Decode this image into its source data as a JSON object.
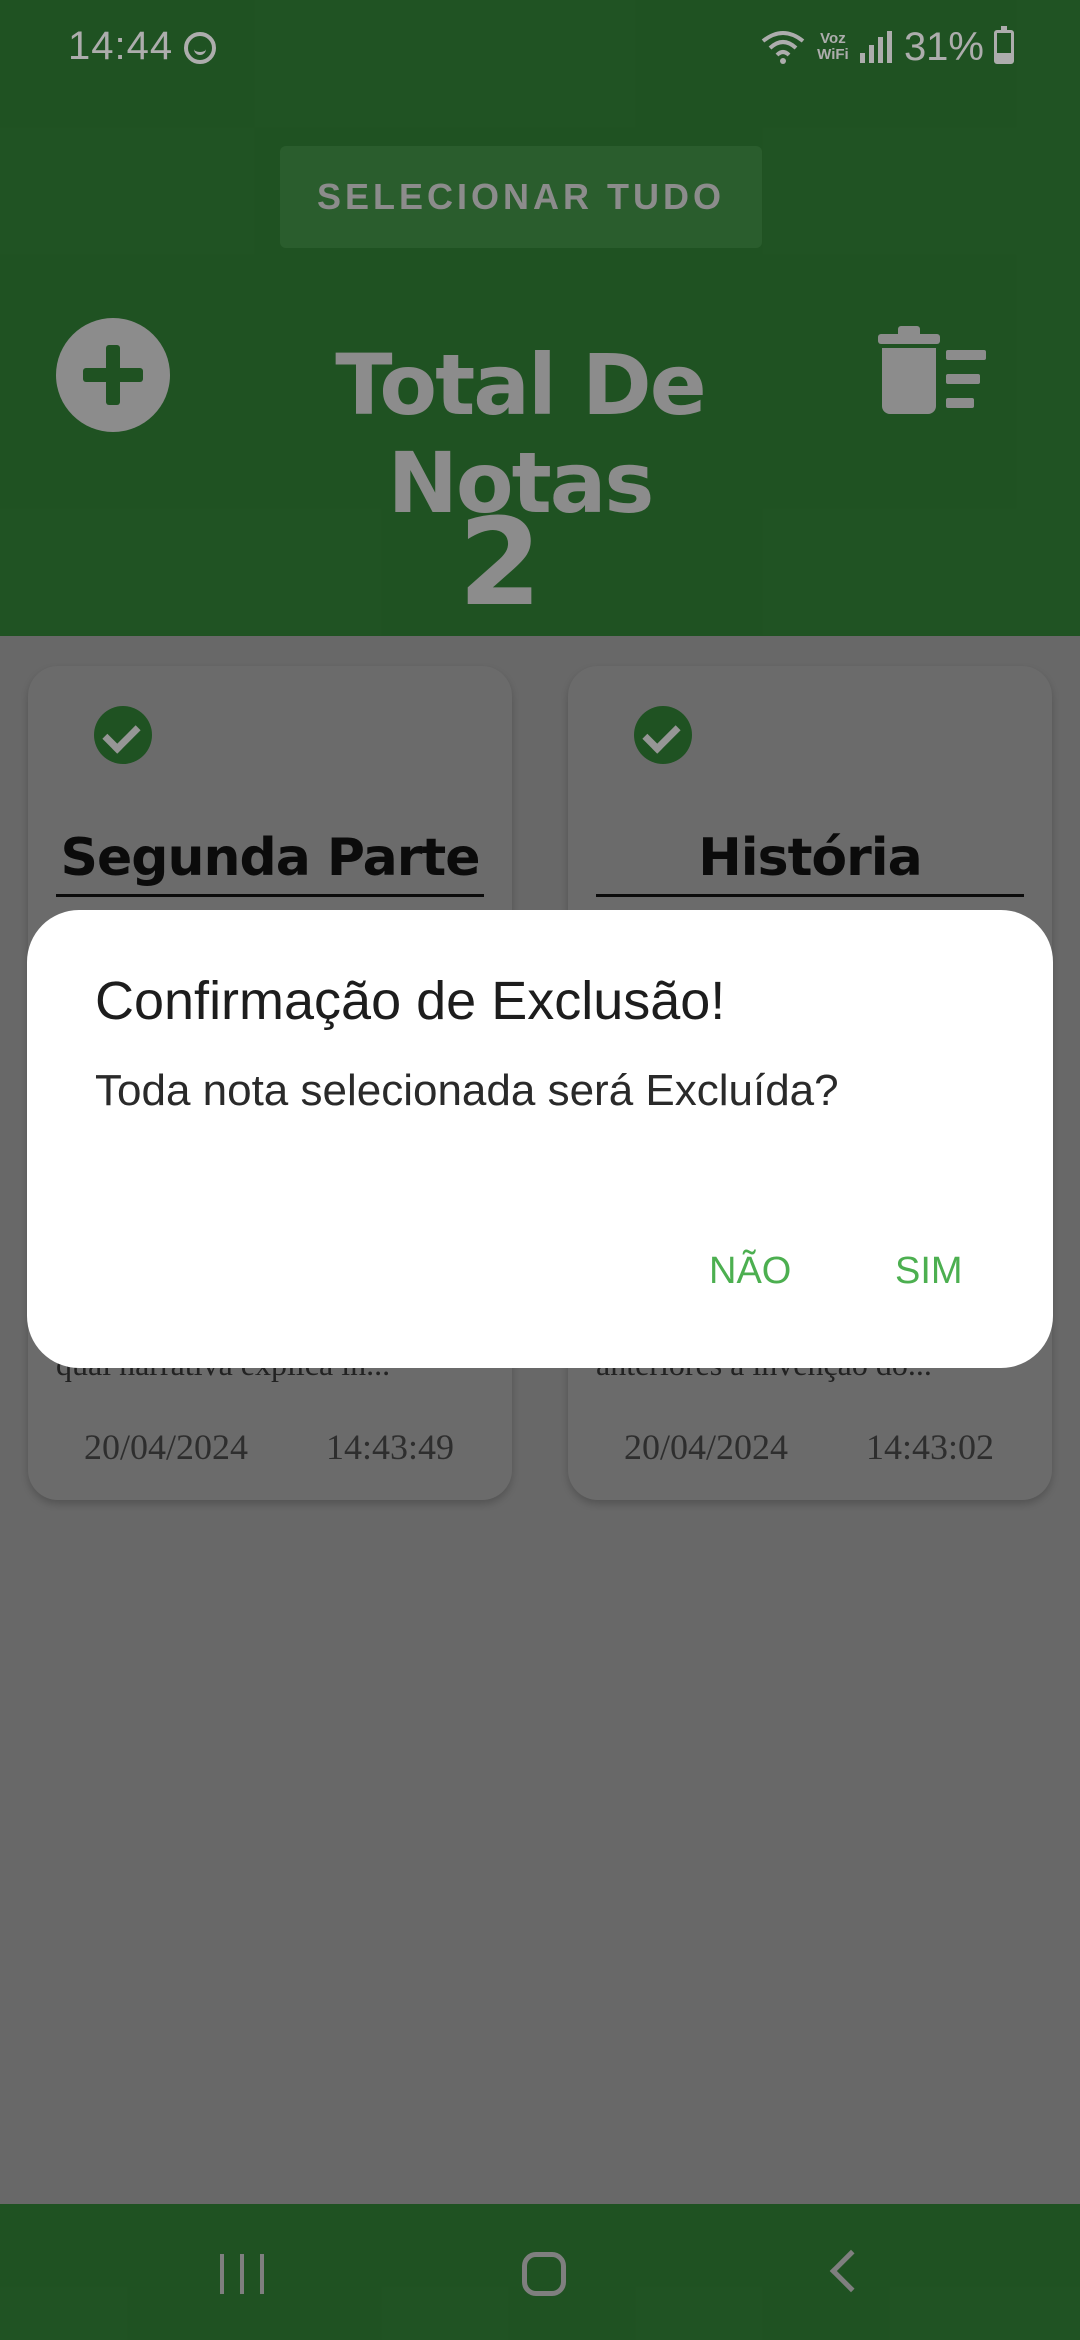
{
  "status_bar": {
    "time": "14:44",
    "voz_label": "Voz\nWiFi",
    "battery": "31%"
  },
  "header": {
    "select_all_label": "SELECIONAR TUDO",
    "title": "Total De Notas",
    "count": "2"
  },
  "notes": [
    {
      "title": "Segunda Parte",
      "body": "qual narrativa explica in...",
      "date": "20/04/2024",
      "time": "14:43:49",
      "selected": true
    },
    {
      "title": "História",
      "body": "anteriores à invenção do...",
      "date": "20/04/2024",
      "time": "14:43:02",
      "selected": true
    }
  ],
  "dialog": {
    "title": "Confirmação de Exclusão!",
    "message": "Toda nota selecionada será Excluída?",
    "no_label": "NÃO",
    "yes_label": "SIM"
  },
  "colors": {
    "header_green": "#2f7a33",
    "accent_button": "#4caf50"
  },
  "icons": [
    "smiley-icon",
    "wifi-icon",
    "signal-icon",
    "battery-icon",
    "add-icon",
    "delete-sweep-icon",
    "check-circle-icon",
    "nav-recents-icon",
    "nav-home-icon",
    "nav-back-icon"
  ]
}
